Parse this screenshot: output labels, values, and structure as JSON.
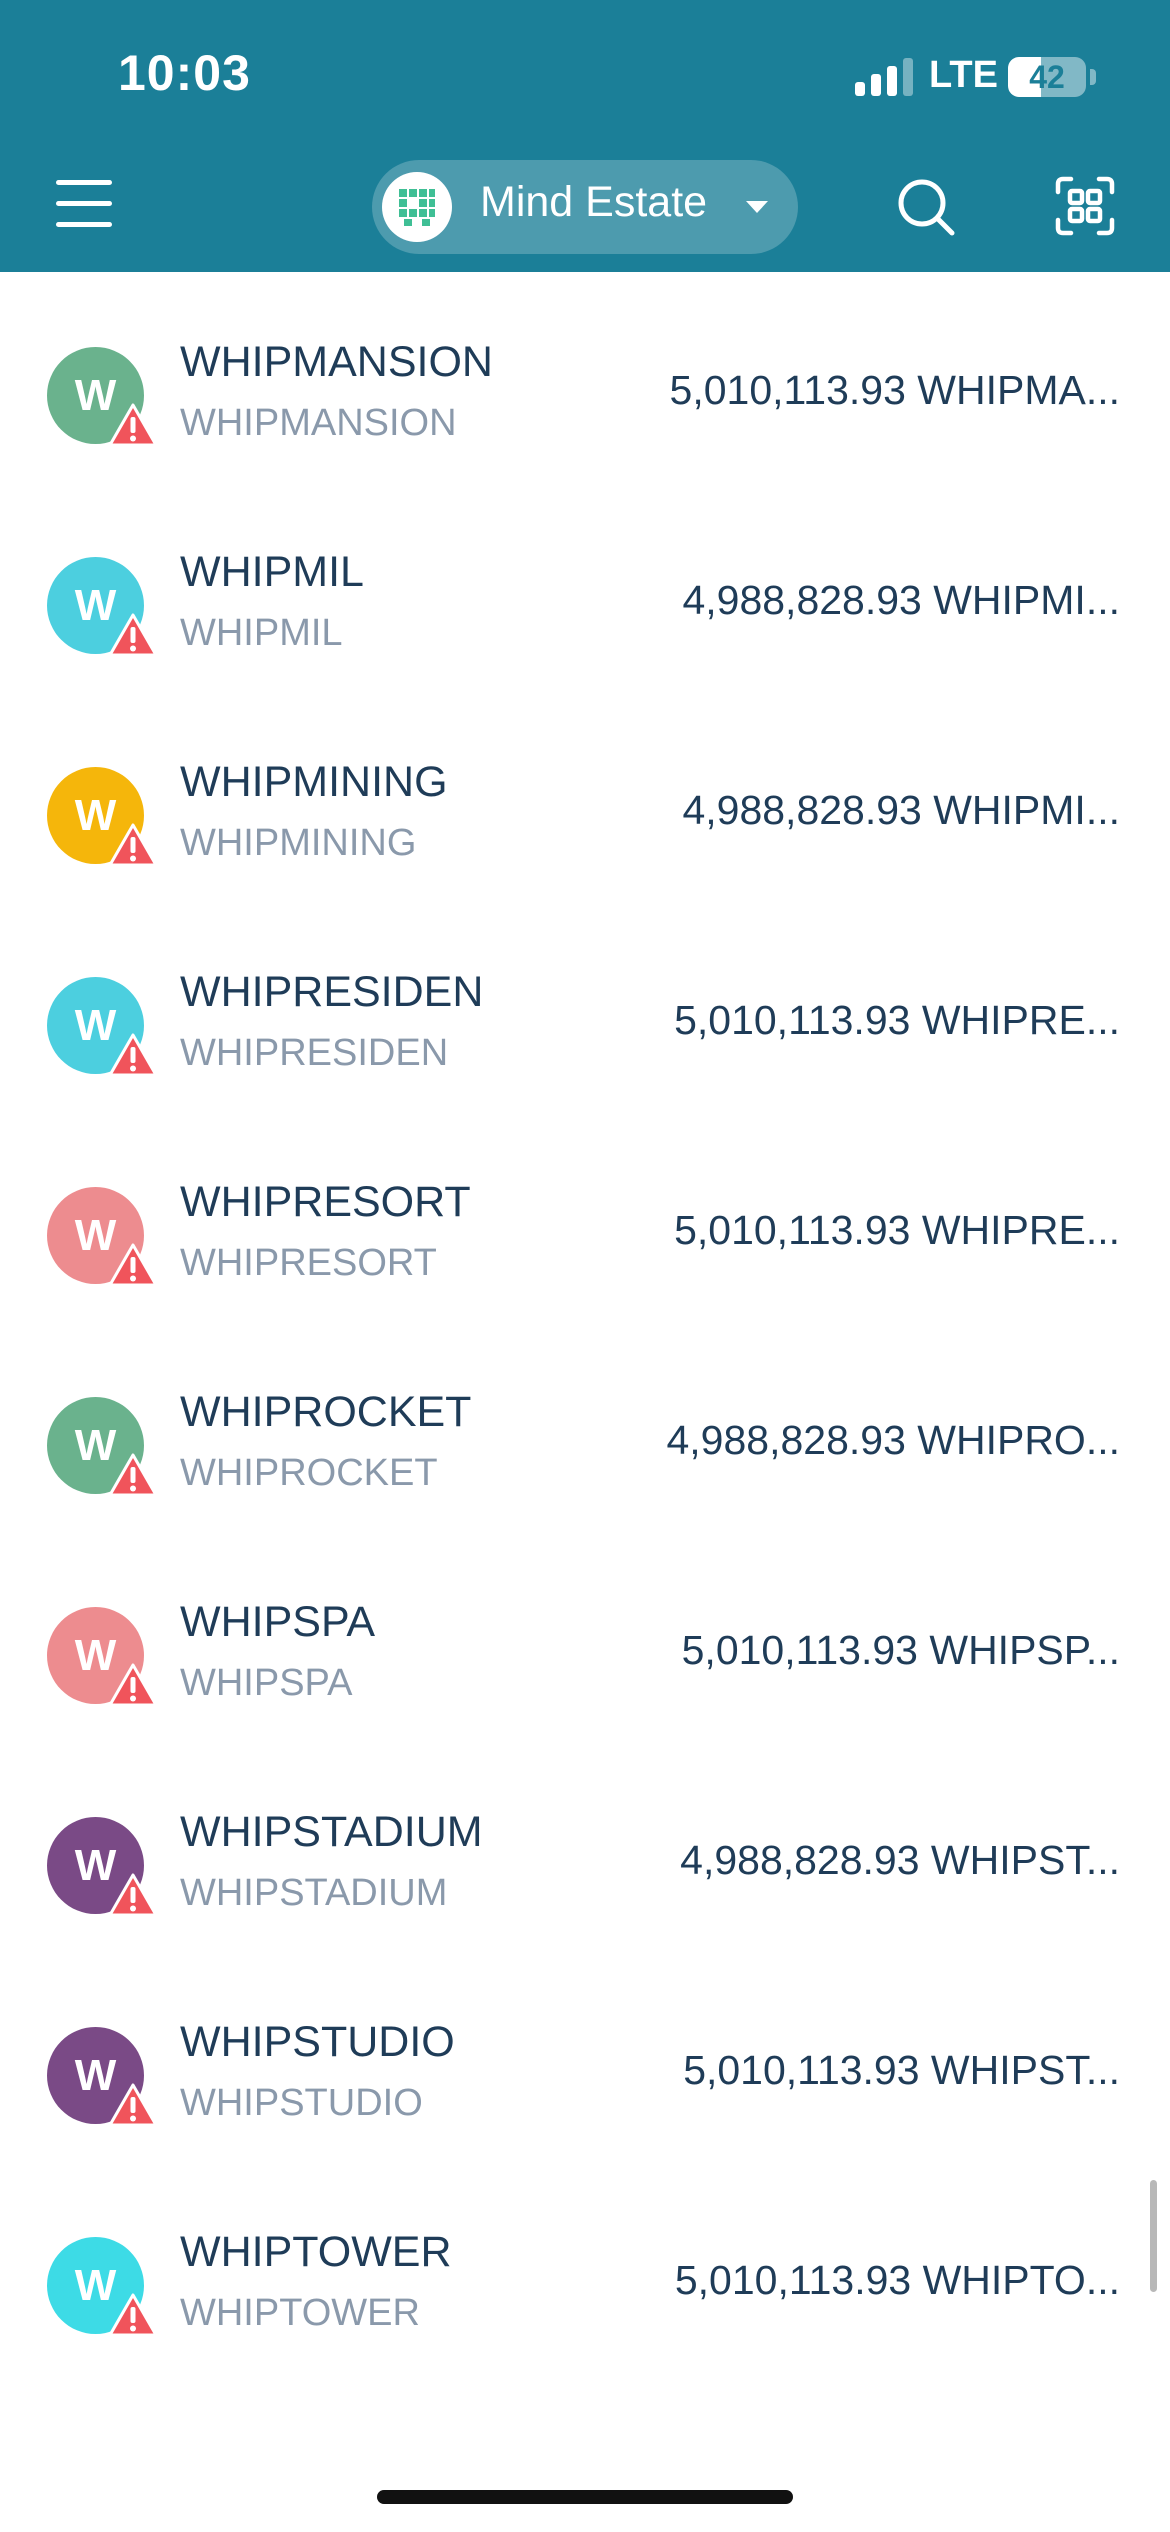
{
  "status_bar": {
    "time": "10:03",
    "network": "LTE",
    "battery": "42",
    "battery_level": 0.42
  },
  "header": {
    "account_name": "Mind Estate",
    "menu_icon": "hamburger-menu-icon",
    "search_icon": "search-icon",
    "scan_icon": "qr-scan-icon"
  },
  "colors": {
    "header_bg": "#1b7f98",
    "primary_text": "#1f3c58",
    "secondary_text": "#8a99ab",
    "warning": "#f0545b"
  },
  "tokens": [
    {
      "initial": "W",
      "symbol": "WHIPMANSION",
      "name": "WHIPMANSION",
      "balance": "5,010,113.93 WHIPMA...",
      "color": "#6ab28d"
    },
    {
      "initial": "W",
      "symbol": "WHIPMIL",
      "name": "WHIPMIL",
      "balance": "4,988,828.93 WHIPMI...",
      "color": "#4ccfdf"
    },
    {
      "initial": "W",
      "symbol": "WHIPMINING",
      "name": "WHIPMINING",
      "balance": "4,988,828.93 WHIPMI...",
      "color": "#f5b60b"
    },
    {
      "initial": "W",
      "symbol": "WHIPRESIDEN",
      "name": "WHIPRESIDEN",
      "balance": "5,010,113.93 WHIPRE...",
      "color": "#4ccfdf"
    },
    {
      "initial": "W",
      "symbol": "WHIPRESORT",
      "name": "WHIPRESORT",
      "balance": "5,010,113.93 WHIPRE...",
      "color": "#ed8c8f"
    },
    {
      "initial": "W",
      "symbol": "WHIPROCKET",
      "name": "WHIPROCKET",
      "balance": "4,988,828.93 WHIPRO...",
      "color": "#6ab28d"
    },
    {
      "initial": "W",
      "symbol": "WHIPSPA",
      "name": "WHIPSPA",
      "balance": "5,010,113.93 WHIPSP...",
      "color": "#ed8c8f"
    },
    {
      "initial": "W",
      "symbol": "WHIPSTADIUM",
      "name": "WHIPSTADIUM",
      "balance": "4,988,828.93 WHIPST...",
      "color": "#7a4a86"
    },
    {
      "initial": "W",
      "symbol": "WHIPSTUDIO",
      "name": "WHIPSTUDIO",
      "balance": "5,010,113.93 WHIPST...",
      "color": "#7a4a86"
    },
    {
      "initial": "W",
      "symbol": "WHIPTOWER",
      "name": "WHIPTOWER",
      "balance": "5,010,113.93 WHIPTO...",
      "color": "#3ddbe6"
    }
  ]
}
